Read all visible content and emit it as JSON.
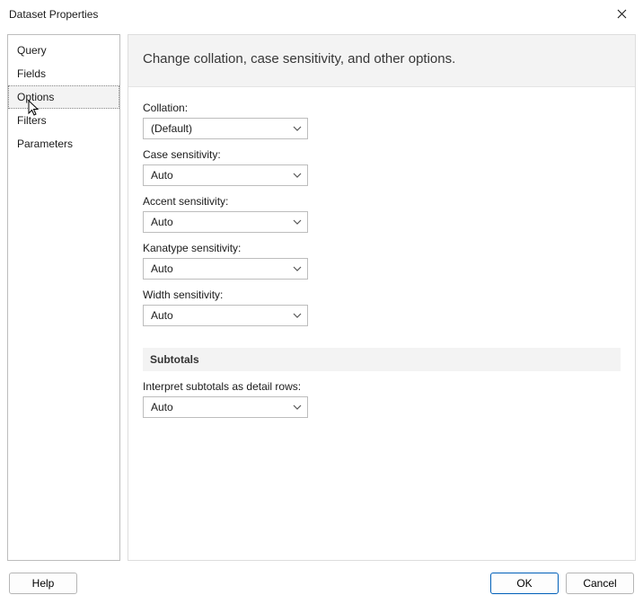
{
  "dialog": {
    "title": "Dataset Properties"
  },
  "sidebar": {
    "items": [
      {
        "label": "Query"
      },
      {
        "label": "Fields"
      },
      {
        "label": "Options"
      },
      {
        "label": "Filters"
      },
      {
        "label": "Parameters"
      }
    ],
    "selected_index": 2
  },
  "banner": {
    "text": "Change collation, case sensitivity, and other options."
  },
  "form": {
    "collation_label": "Collation:",
    "collation_value": "(Default)",
    "case_label": "Case sensitivity:",
    "case_value": "Auto",
    "accent_label": "Accent sensitivity:",
    "accent_value": "Auto",
    "kanatype_label": "Kanatype sensitivity:",
    "kanatype_value": "Auto",
    "width_label": "Width sensitivity:",
    "width_value": "Auto"
  },
  "subtotals": {
    "heading": "Subtotals",
    "interpret_label": "Interpret subtotals as detail rows:",
    "interpret_value": "Auto"
  },
  "footer": {
    "help": "Help",
    "ok": "OK",
    "cancel": "Cancel"
  }
}
